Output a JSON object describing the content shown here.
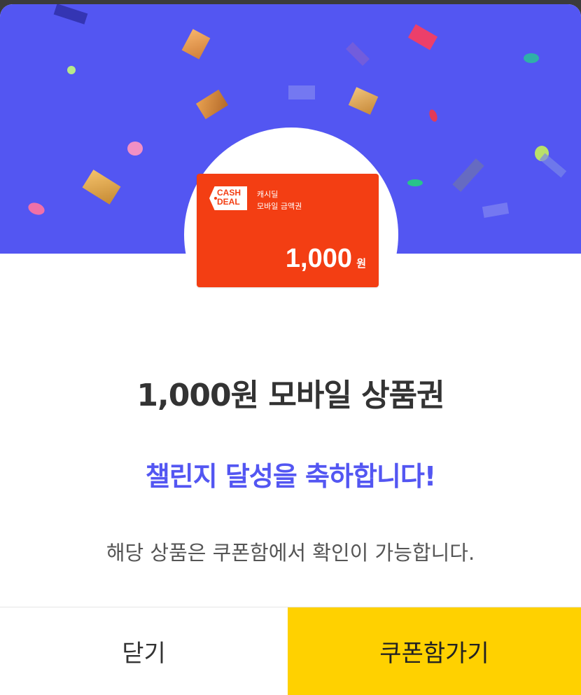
{
  "voucher": {
    "logo_text": "CASH\nDEAL",
    "brand": "캐시딜",
    "description": "모바일 금액권",
    "amount": "1,000",
    "unit": "원"
  },
  "content": {
    "title": "1,000원 모바일 상품권",
    "congrats": "챌린지 달성을 축하합니다!",
    "notice": "해당 상품은 쿠폰함에서 확인이 가능합니다."
  },
  "buttons": {
    "close_label": "닫기",
    "go_label": "쿠폰함가기"
  },
  "colors": {
    "banner": "#5356f2",
    "voucher": "#f33e13",
    "accent_text": "#5356f2",
    "primary_button": "#ffd100"
  }
}
